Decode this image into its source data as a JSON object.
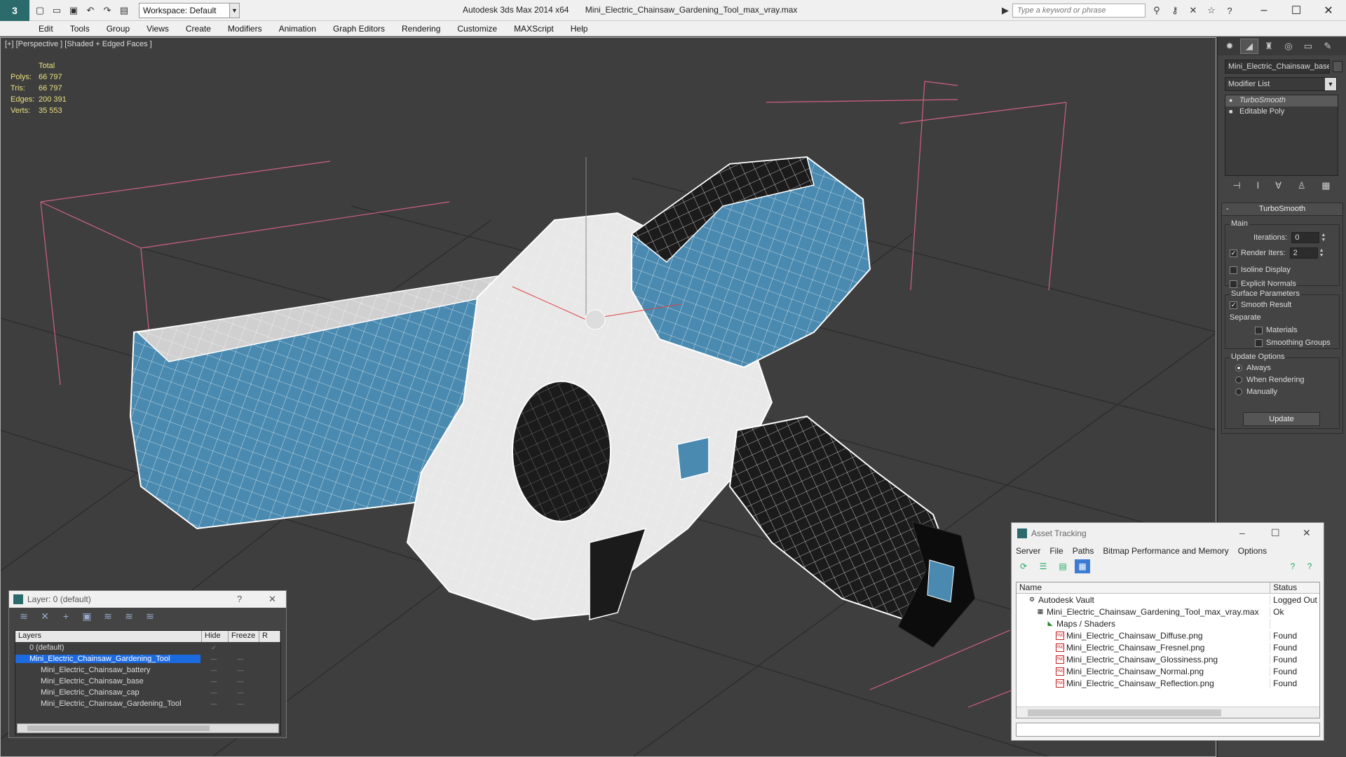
{
  "titlebar": {
    "workspace": "Workspace: Default",
    "app_name": "Autodesk 3ds Max  2014 x64",
    "file_name": "Mini_Electric_Chainsaw_Gardening_Tool_max_vray.max",
    "search_placeholder": "Type a keyword or phrase"
  },
  "menu": [
    "Edit",
    "Tools",
    "Group",
    "Views",
    "Create",
    "Modifiers",
    "Animation",
    "Graph Editors",
    "Rendering",
    "Customize",
    "MAXScript",
    "Help"
  ],
  "viewport": {
    "label": "[+] [Perspective ] [Shaded + Edged Faces ]",
    "stats": {
      "header": "Total",
      "rows": [
        {
          "k": "Polys:",
          "v": "66 797"
        },
        {
          "k": "Tris:",
          "v": "66 797"
        },
        {
          "k": "Edges:",
          "v": "200 391"
        },
        {
          "k": "Verts:",
          "v": "35 553"
        }
      ]
    }
  },
  "command_panel": {
    "object_name": "Mini_Electric_Chainsaw_base",
    "modifier_list": "Modifier List",
    "stack": [
      "TurboSmooth",
      "Editable Poly"
    ],
    "rollout_title": "TurboSmooth",
    "main_group": "Main",
    "iterations_label": "Iterations:",
    "iterations_value": "0",
    "render_iters_label": "Render Iters:",
    "render_iters_value": "2",
    "isoline": "Isoline Display",
    "explicit_normals": "Explicit Normals",
    "surface_group": "Surface Parameters",
    "smooth_result": "Smooth Result",
    "separate": "Separate",
    "materials": "Materials",
    "smoothing_groups": "Smoothing Groups",
    "update_group": "Update Options",
    "always": "Always",
    "when_rendering": "When Rendering",
    "manually": "Manually",
    "update_btn": "Update"
  },
  "layer_dialog": {
    "title": "Layer: 0 (default)",
    "columns": [
      "Layers",
      "Hide",
      "Freeze",
      "R"
    ],
    "rows": [
      {
        "name": "0 (default)",
        "indent": 1
      },
      {
        "name": "Mini_Electric_Chainsaw_Gardening_Tool",
        "indent": 1
      },
      {
        "name": "Mini_Electric_Chainsaw_battery",
        "indent": 2
      },
      {
        "name": "Mini_Electric_Chainsaw_base",
        "indent": 2
      },
      {
        "name": "Mini_Electric_Chainsaw_cap",
        "indent": 2
      },
      {
        "name": "Mini_Electric_Chainsaw_Gardening_Tool",
        "indent": 2
      }
    ]
  },
  "asset_dialog": {
    "title": "Asset Tracking",
    "menu": [
      "Server",
      "File",
      "Paths",
      "Bitmap Performance and Memory",
      "Options"
    ],
    "columns": [
      "Name",
      "Status"
    ],
    "rows": [
      {
        "name": "Autodesk Vault",
        "status": "Logged Out",
        "indent": 1,
        "icon": "vault"
      },
      {
        "name": "Mini_Electric_Chainsaw_Gardening_Tool_max_vray.max",
        "status": "Ok",
        "indent": 2,
        "icon": "max"
      },
      {
        "name": "Maps / Shaders",
        "status": "",
        "indent": 3,
        "icon": "folder"
      },
      {
        "name": "Mini_Electric_Chainsaw_Diffuse.png",
        "status": "Found",
        "indent": 4,
        "icon": "png"
      },
      {
        "name": "Mini_Electric_Chainsaw_Fresnel.png",
        "status": "Found",
        "indent": 4,
        "icon": "png"
      },
      {
        "name": "Mini_Electric_Chainsaw_Glossiness.png",
        "status": "Found",
        "indent": 4,
        "icon": "png"
      },
      {
        "name": "Mini_Electric_Chainsaw_Normal.png",
        "status": "Found",
        "indent": 4,
        "icon": "png"
      },
      {
        "name": "Mini_Electric_Chainsaw_Reflection.png",
        "status": "Found",
        "indent": 4,
        "icon": "png"
      }
    ]
  },
  "colors": {
    "accent_blue": "#4a8ab0",
    "selection": "#1c6ae0",
    "stats_yellow": "#e8e080",
    "bbox_pink": "#d06080"
  }
}
